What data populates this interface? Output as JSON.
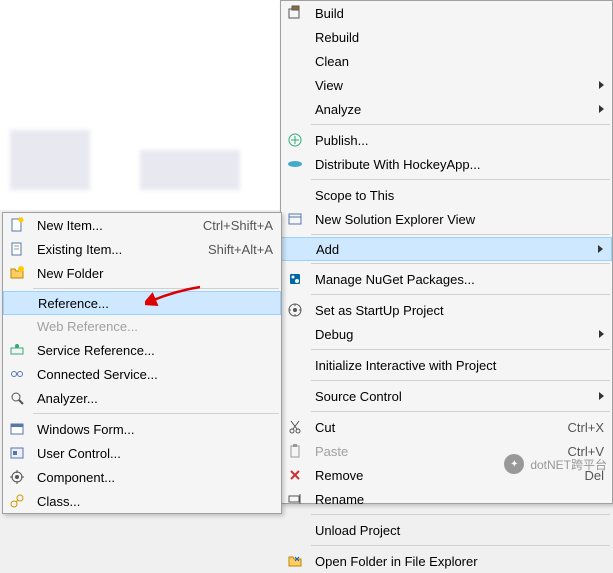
{
  "mainMenu": {
    "items": [
      {
        "label": "Build",
        "icon": "build-icon"
      },
      {
        "label": "Rebuild"
      },
      {
        "label": "Clean"
      },
      {
        "label": "View",
        "submenu": true
      },
      {
        "label": "Analyze",
        "submenu": true
      },
      {
        "sep": true
      },
      {
        "label": "Publish...",
        "icon": "publish-icon"
      },
      {
        "label": "Distribute With HockeyApp...",
        "icon": "hockey-icon"
      },
      {
        "sep": true
      },
      {
        "label": "Scope to This"
      },
      {
        "label": "New Solution Explorer View",
        "icon": "new-view-icon"
      },
      {
        "sep": true
      },
      {
        "label": "Add",
        "submenu": true,
        "highlighted": true
      },
      {
        "sep": true
      },
      {
        "label": "Manage NuGet Packages...",
        "icon": "nuget-icon"
      },
      {
        "sep": true
      },
      {
        "label": "Set as StartUp Project",
        "icon": "startup-icon"
      },
      {
        "label": "Debug",
        "submenu": true
      },
      {
        "sep": true
      },
      {
        "label": "Initialize Interactive with Project"
      },
      {
        "sep": true
      },
      {
        "label": "Source Control",
        "submenu": true
      },
      {
        "sep": true
      },
      {
        "label": "Cut",
        "icon": "cut-icon",
        "shortcut": "Ctrl+X"
      },
      {
        "label": "Paste",
        "icon": "paste-icon",
        "shortcut": "Ctrl+V",
        "disabled": true
      },
      {
        "label": "Remove",
        "icon": "remove-icon",
        "shortcut": "Del"
      },
      {
        "label": "Rename",
        "icon": "rename-icon"
      },
      {
        "sep": true
      },
      {
        "label": "Unload Project"
      },
      {
        "sep": true
      },
      {
        "label": "Open Folder in File Explorer",
        "icon": "folder-open-icon"
      }
    ]
  },
  "subMenu": {
    "items": [
      {
        "label": "New Item...",
        "icon": "new-item-icon",
        "shortcut": "Ctrl+Shift+A"
      },
      {
        "label": "Existing Item...",
        "icon": "existing-item-icon",
        "shortcut": "Shift+Alt+A"
      },
      {
        "label": "New Folder",
        "icon": "new-folder-icon"
      },
      {
        "sep": true
      },
      {
        "label": "Reference...",
        "highlighted": true
      },
      {
        "label": "Web Reference...",
        "disabled": true
      },
      {
        "label": "Service Reference...",
        "icon": "service-ref-icon"
      },
      {
        "label": "Connected Service...",
        "icon": "connected-svc-icon"
      },
      {
        "label": "Analyzer...",
        "icon": "analyzer-icon"
      },
      {
        "sep": true
      },
      {
        "label": "Windows Form...",
        "icon": "winform-icon"
      },
      {
        "label": "User Control...",
        "icon": "usercontrol-icon"
      },
      {
        "label": "Component...",
        "icon": "component-icon"
      },
      {
        "label": "Class...",
        "icon": "class-icon"
      }
    ]
  },
  "watermark": {
    "text": "dotNET跨平台"
  }
}
